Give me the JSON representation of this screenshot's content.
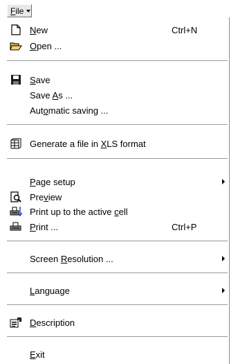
{
  "menu": {
    "title": "File",
    "title_hotkey": "F",
    "title_rest": "ile"
  },
  "items": [
    {
      "pre": "",
      "key": "N",
      "post": "ew",
      "shortcut": "Ctrl+N",
      "icon": "new-document-icon"
    },
    {
      "pre": "",
      "key": "O",
      "post": "pen ...",
      "shortcut": "",
      "icon": "open-folder-icon"
    },
    {
      "pre": "",
      "key": "S",
      "post": "ave",
      "shortcut": "",
      "icon": "save-disk-icon"
    },
    {
      "pre": "Save ",
      "key": "A",
      "post": "s ...",
      "shortcut": "",
      "icon": ""
    },
    {
      "pre": "Aut",
      "key": "o",
      "post": "matic saving ...",
      "shortcut": "",
      "icon": ""
    },
    {
      "pre": "Generate a file in ",
      "key": "X",
      "post": "LS format",
      "shortcut": "",
      "icon": "spreadsheet-icon"
    },
    {
      "pre": "",
      "key": "P",
      "post": "age setup",
      "shortcut": "",
      "icon": "",
      "submenu": true
    },
    {
      "pre": "Pre",
      "key": "v",
      "post": "iew",
      "shortcut": "",
      "icon": "print-preview-icon"
    },
    {
      "pre": "Print up to the active ",
      "key": "c",
      "post": "ell",
      "shortcut": "",
      "icon": "print-partial-icon"
    },
    {
      "pre": "",
      "key": "P",
      "post": "rint ...",
      "shortcut": "Ctrl+P",
      "icon": "printer-icon"
    },
    {
      "pre": "Screen ",
      "key": "R",
      "post": "esolution ...",
      "shortcut": "",
      "icon": "",
      "submenu": true
    },
    {
      "pre": "",
      "key": "L",
      "post": "anguage",
      "shortcut": "",
      "icon": "",
      "submenu": true
    },
    {
      "pre": "",
      "key": "D",
      "post": "escription",
      "shortcut": "",
      "icon": "properties-icon"
    },
    {
      "pre": "",
      "key": "E",
      "post": "xit",
      "shortcut": "",
      "icon": ""
    }
  ]
}
